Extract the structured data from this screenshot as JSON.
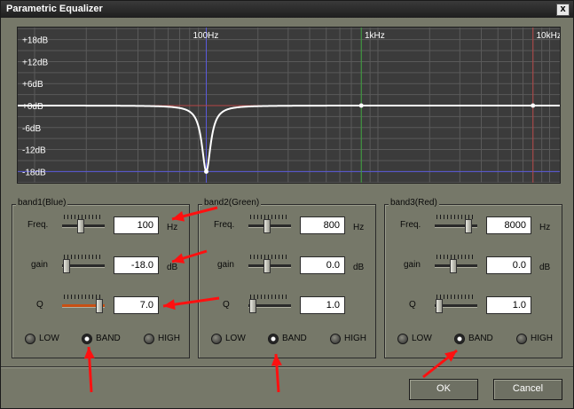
{
  "window": {
    "title": "Parametric Equalizer",
    "close_label": "x"
  },
  "graph": {
    "db_labels": [
      "+18dB",
      "+12dB",
      "+6dB",
      "+0dB",
      "-6dB",
      "-12dB",
      "-18dB"
    ],
    "freq_labels": [
      "100Hz",
      "1kHz",
      "10kHz"
    ],
    "colors": {
      "background": "#3b3b3b",
      "grid": "#5a5a5a",
      "curve": "#ffffff",
      "blue": "#5a5adc",
      "green": "#3ca03c",
      "red": "#b44646"
    }
  },
  "labels": {
    "freq": "Freq.",
    "gain": "gain",
    "q": "Q",
    "hz": "Hz",
    "db": "dB"
  },
  "bands": [
    {
      "title": "band1(Blue)",
      "freq": "100",
      "gain": "-18.0",
      "q": "7.0",
      "freq_pos": 0.42,
      "gain_pos": 0.02,
      "q_pos": 0.95,
      "types": [
        "LOW",
        "BAND",
        "HIGH"
      ],
      "selected": "BAND"
    },
    {
      "title": "band2(Green)",
      "freq": "800",
      "gain": "0.0",
      "q": "1.0",
      "freq_pos": 0.42,
      "gain_pos": 0.42,
      "q_pos": 0.02,
      "types": [
        "LOW",
        "BAND",
        "HIGH"
      ],
      "selected": "BAND"
    },
    {
      "title": "band3(Red)",
      "freq": "8000",
      "gain": "0.0",
      "q": "1.0",
      "freq_pos": 0.85,
      "gain_pos": 0.42,
      "q_pos": 0.02,
      "types": [
        "LOW",
        "BAND",
        "HIGH"
      ],
      "selected": "BAND"
    }
  ],
  "buttons": {
    "ok": "OK",
    "cancel": "Cancel"
  },
  "annotation_color": "#ff1010"
}
